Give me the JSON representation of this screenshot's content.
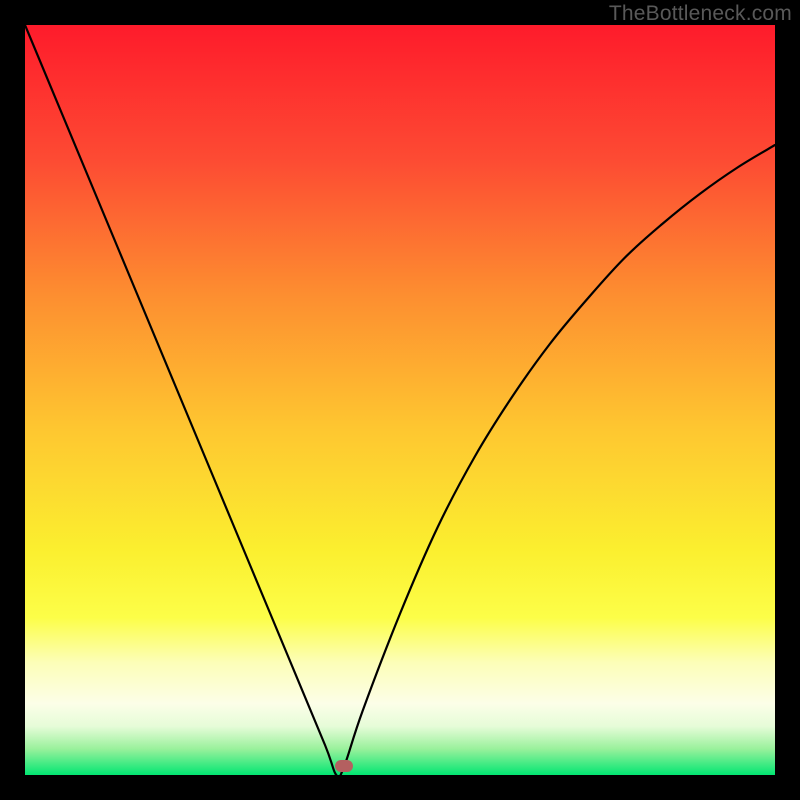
{
  "watermark": "TheBottleneck.com",
  "colors": {
    "frame": "#000000",
    "curve": "#000000",
    "marker": "#b46060",
    "gradient_stops": [
      {
        "pos": 0.0,
        "color": "#fe1b2b"
      },
      {
        "pos": 0.18,
        "color": "#fd4b33"
      },
      {
        "pos": 0.36,
        "color": "#fd8e30"
      },
      {
        "pos": 0.54,
        "color": "#fec730"
      },
      {
        "pos": 0.7,
        "color": "#fbef2f"
      },
      {
        "pos": 0.79,
        "color": "#fcfe48"
      },
      {
        "pos": 0.85,
        "color": "#fcfeb8"
      },
      {
        "pos": 0.905,
        "color": "#fcfee8"
      },
      {
        "pos": 0.935,
        "color": "#e6fcd8"
      },
      {
        "pos": 0.965,
        "color": "#9af19c"
      },
      {
        "pos": 1.0,
        "color": "#02e672"
      }
    ]
  },
  "chart_data": {
    "type": "line",
    "title": "",
    "xlabel": "",
    "ylabel": "",
    "xlim": [
      0,
      1
    ],
    "ylim": [
      0,
      1
    ],
    "note": "V-shaped bottleneck curve; y is bottleneck fraction (0 at optimum). Curve estimated from pixel positions.",
    "optimum_x": 0.415,
    "marker": {
      "x": 0.425,
      "y": 0.012
    },
    "series": [
      {
        "name": "bottleneck-curve",
        "x": [
          0.0,
          0.05,
          0.1,
          0.15,
          0.2,
          0.25,
          0.3,
          0.35,
          0.4,
          0.415,
          0.425,
          0.45,
          0.5,
          0.55,
          0.6,
          0.65,
          0.7,
          0.75,
          0.8,
          0.85,
          0.9,
          0.95,
          1.0
        ],
        "y": [
          1.0,
          0.88,
          0.76,
          0.64,
          0.52,
          0.4,
          0.28,
          0.16,
          0.04,
          0.0,
          0.01,
          0.085,
          0.215,
          0.33,
          0.425,
          0.505,
          0.575,
          0.635,
          0.69,
          0.735,
          0.775,
          0.81,
          0.84
        ]
      }
    ]
  }
}
